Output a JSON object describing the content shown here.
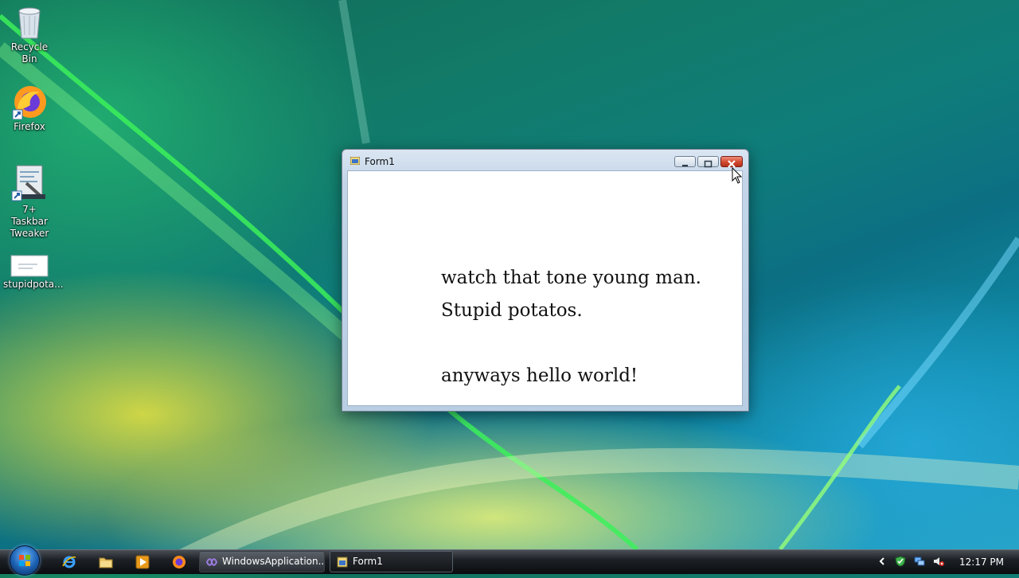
{
  "desktop": {
    "icons": [
      {
        "label": "Recycle Bin",
        "icon": "recycle-bin-icon"
      },
      {
        "label": "Firefox",
        "icon": "firefox-icon"
      },
      {
        "label": "7+ Taskbar Tweaker",
        "icon": "taskbar-tweaker-icon"
      },
      {
        "label": "stupidpota...",
        "icon": "text-file-icon"
      }
    ]
  },
  "window": {
    "title": "Form1",
    "lines": [
      "watch that tone young man.",
      "Stupid potatos.",
      "anyways hello world!"
    ]
  },
  "taskbar": {
    "buttons": [
      {
        "label": "WindowsApplication...",
        "icon": "visual-studio-icon"
      },
      {
        "label": "Form1",
        "icon": "form-app-icon"
      }
    ],
    "clock": "12:17 PM"
  }
}
